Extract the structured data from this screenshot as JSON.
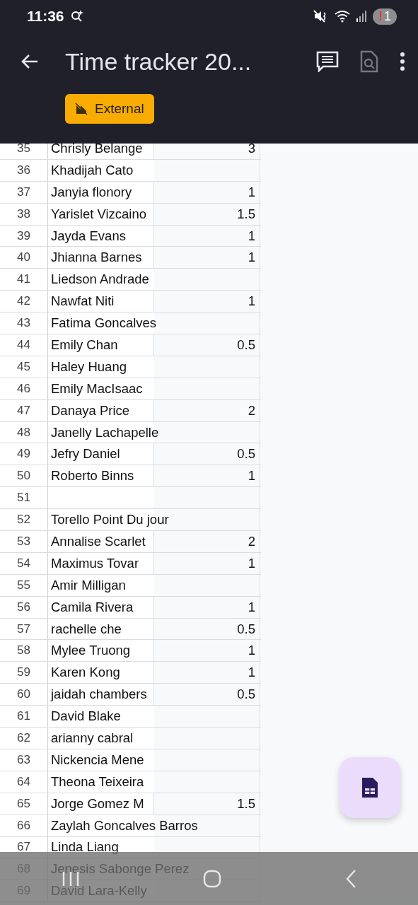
{
  "status_bar": {
    "time": "11:36",
    "badge_alert": "!",
    "badge_count": "1"
  },
  "app_bar": {
    "title": "Time tracker 20...",
    "comments_disabled": false,
    "preview_disabled": true
  },
  "chip": {
    "label": "External"
  },
  "rows": [
    {
      "number": "35",
      "name": "Chrisly Belange",
      "value": "3"
    },
    {
      "number": "36",
      "name": "Khadijah Cato"
    },
    {
      "number": "37",
      "name": "Janyia flonory",
      "value": "1"
    },
    {
      "number": "38",
      "name": "Yarislet Vizcaino",
      "value": "1.5"
    },
    {
      "number": "39",
      "name": "Jayda Evans",
      "value": "1"
    },
    {
      "number": "40",
      "name": "Jhianna Barnes",
      "value": "1"
    },
    {
      "number": "41",
      "name": "Liedson Andrade"
    },
    {
      "number": "42",
      "name": "Nawfat Niti",
      "value": "1"
    },
    {
      "number": "43",
      "name": "Fatima Goncalves"
    },
    {
      "number": "44",
      "name": "Emily Chan",
      "value": "0.5"
    },
    {
      "number": "45",
      "name": "Haley Huang"
    },
    {
      "number": "46",
      "name": "Emily MacIsaac"
    },
    {
      "number": "47",
      "name": "Danaya Price",
      "value": "2"
    },
    {
      "number": "48",
      "name": "Janelly Lachapelle"
    },
    {
      "number": "49",
      "name": "Jefry Daniel",
      "value": "0.5"
    },
    {
      "number": "50",
      "name": "Roberto Binns",
      "value": "1"
    },
    {
      "number": "51"
    },
    {
      "number": "52",
      "name": "Torello Point Du jour"
    },
    {
      "number": "53",
      "name": "Annalise Scarlet",
      "value": "2"
    },
    {
      "number": "54",
      "name": "Maximus Tovar",
      "value": "1"
    },
    {
      "number": "55",
      "name": "Amir Milligan"
    },
    {
      "number": "56",
      "name": "Camila Rivera",
      "value": "1"
    },
    {
      "number": "57",
      "name": "rachelle che",
      "value": "0.5"
    },
    {
      "number": "58",
      "name": "Mylee Truong",
      "value": "1"
    },
    {
      "number": "59",
      "name": "Karen Kong",
      "value": "1"
    },
    {
      "number": "60",
      "name": "jaidah chambers",
      "value": "0.5"
    },
    {
      "number": "61",
      "name": "David Blake"
    },
    {
      "number": "62",
      "name": "arianny cabral"
    },
    {
      "number": "63",
      "name": "Nickencia Mene"
    },
    {
      "number": "64",
      "name": "Theona Teixeira"
    },
    {
      "number": "65",
      "name": "Jorge Gomez M",
      "value": "1.5"
    },
    {
      "number": "66",
      "name": "Zaylah Goncalves Barros"
    },
    {
      "number": "67",
      "name": "Linda Liang"
    },
    {
      "number": "68",
      "name": "Jenesis Sabonge Perez"
    },
    {
      "number": "69",
      "name": "David Lara-Kelly"
    }
  ]
}
